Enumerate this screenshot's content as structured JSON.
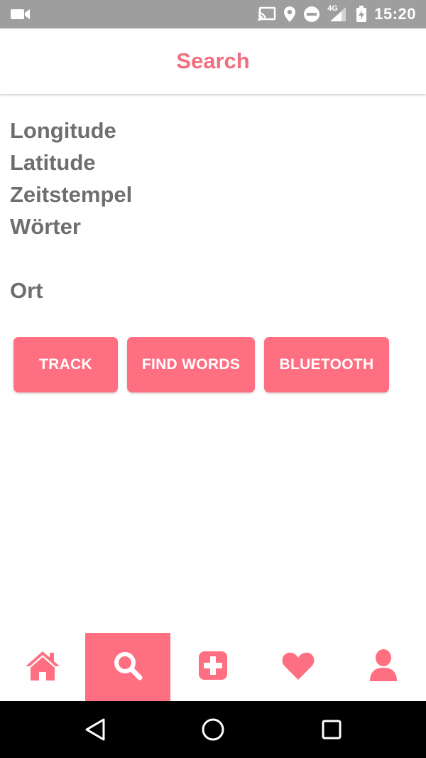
{
  "status_bar": {
    "time": "15:20",
    "network": "4G",
    "icons": [
      "video-camera-icon",
      "cast-icon",
      "location-pin-icon",
      "do-not-disturb-icon",
      "signal-icon",
      "battery-charging-icon"
    ]
  },
  "app_bar": {
    "title": "Search"
  },
  "info": {
    "longitude": "Longitude",
    "latitude": "Latitude",
    "timestamp": "Zeitstempel",
    "words": "Wörter",
    "place": "Ort"
  },
  "buttons": {
    "track": "TRACK",
    "find_words": "FIND WORDS",
    "bluetooth": "BLUETOOTH"
  },
  "bottom_nav": {
    "items": [
      {
        "icon": "home-icon",
        "active": false
      },
      {
        "icon": "search-icon",
        "active": true
      },
      {
        "icon": "add-icon",
        "active": false
      },
      {
        "icon": "heart-icon",
        "active": false
      },
      {
        "icon": "user-icon",
        "active": false
      }
    ]
  },
  "system_nav": {
    "icons": [
      "back-icon",
      "home-circle-icon",
      "recents-icon"
    ]
  },
  "colors": {
    "accent": "#ff6f82",
    "title": "#f07080",
    "text": "#6e6e6e",
    "status_bar": "#9e9e9e"
  }
}
